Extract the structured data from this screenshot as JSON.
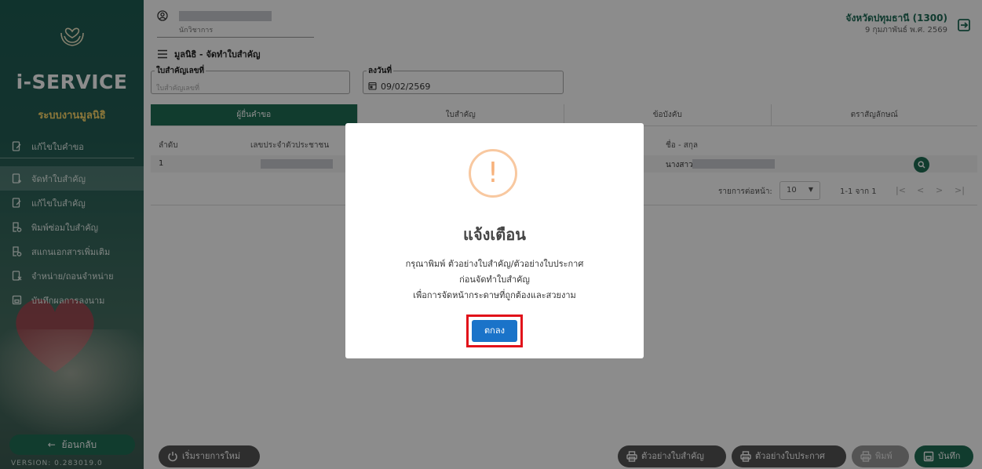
{
  "sidebar": {
    "brand": "i-SERVICE",
    "subtitle": "ระบบงานมูลนิธิ",
    "items": [
      {
        "label": "แก้ไขใบคำขอ"
      },
      {
        "label": "จัดทำใบสำคัญ"
      },
      {
        "label": "แก้ไขใบสำคัญ"
      },
      {
        "label": "พิมพ์ซ่อมใบสำคัญ"
      },
      {
        "label": "สแกนเอกสารเพิ่มเติม"
      },
      {
        "label": "จำหน่าย/ถอนจำหน่าย"
      },
      {
        "label": "บันทึกผลการลงนาม"
      }
    ],
    "back_label": "ย้อนกลับ",
    "version": "VERSION: 0.283019.0"
  },
  "header": {
    "user_role": "นักวิชาการ",
    "province": "จังหวัดปทุมธานี (1300)",
    "date": "9 กุมภาพันธ์ พ.ศ. 2569"
  },
  "breadcrumb": "มูลนิธิ - จัดทำใบสำคัญ",
  "form": {
    "doc_no_label": "ใบสำคัญเลขที่",
    "doc_no_placeholder": "ใบสำคัญเลขที่",
    "date_label": "ลงวันที่",
    "date_value": "09/02/2569"
  },
  "tabs": [
    {
      "label": "ผู้ยื่นคำขอ"
    },
    {
      "label": "ใบสำคัญ"
    },
    {
      "label": "ข้อบังคับ"
    },
    {
      "label": "ตราสัญลักษณ์"
    }
  ],
  "table": {
    "headers": [
      "ลำดับ",
      "เลขประจำตัวประชาชน",
      "ชื่อ - สกุล"
    ],
    "rows": [
      {
        "index": "1",
        "name_prefix": "นางสาว"
      }
    ]
  },
  "pager": {
    "rows_per_page_label": "รายการต่อหน้า:",
    "rows_per_page": "10",
    "range": "1-1 จาก 1"
  },
  "modal": {
    "icon": "!",
    "title": "แจ้งเตือน",
    "lines": [
      "กรุณาพิมพ์ ตัวอย่างใบสำคัญ/ตัวอย่างใบประกาศ",
      "ก่อนจัดทำใบสำคัญ",
      "เพื่อการจัดหน้ากระดาษที่ถูกต้องและสวยงาม"
    ],
    "ok_label": "ตกลง"
  },
  "footer": {
    "restart_label": "เริ่มรายการใหม่",
    "sample_doc_label": "ตัวอย่างใบสำคัญ",
    "sample_cert_label": "ตัวอย่างใบประกาศ",
    "print_label": "พิมพ์",
    "save_label": "บันทึก"
  }
}
